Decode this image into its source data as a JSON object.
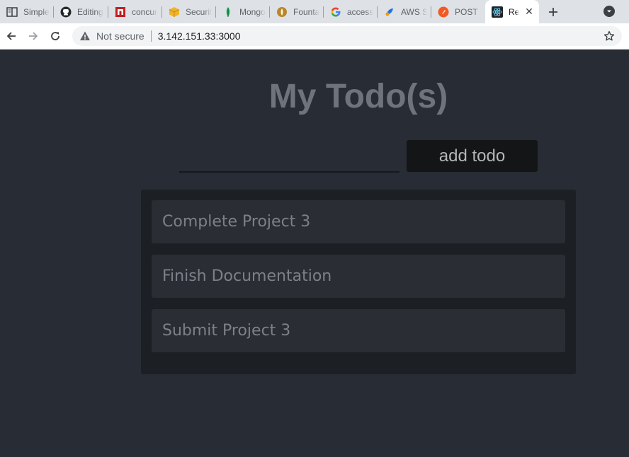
{
  "browser": {
    "tabs": [
      {
        "label": "Simple",
        "icon": "book-icon"
      },
      {
        "label": "Editing",
        "icon": "github-icon"
      },
      {
        "label": "concur",
        "icon": "n-logo-icon"
      },
      {
        "label": "Securit",
        "icon": "package-icon"
      },
      {
        "label": "Mongo",
        "icon": "leaf-icon"
      },
      {
        "label": "Founta",
        "icon": "fountain-icon"
      },
      {
        "label": "access",
        "icon": "google-icon"
      },
      {
        "label": "AWS S",
        "icon": "aws-icon"
      },
      {
        "label": "POST -",
        "icon": "postman-icon"
      },
      {
        "label": "Re",
        "icon": "react-icon"
      }
    ],
    "address": {
      "security_label": "Not secure",
      "url": "3.142.151.33:3000"
    },
    "colors": {
      "tabstrip": "#dee1e6",
      "toolbar": "#ffffff",
      "omnibox": "#f1f3f4"
    }
  },
  "app": {
    "title": "My Todo(s)",
    "input_value": "",
    "add_button_label": "add todo",
    "todos": [
      "Complete Project 3",
      "Finish Documentation",
      "Submit Project 3"
    ],
    "colors": {
      "background": "#282c34",
      "list_panel": "#1c1f23",
      "list_item": "#2a2d34",
      "button": "#141516"
    }
  }
}
